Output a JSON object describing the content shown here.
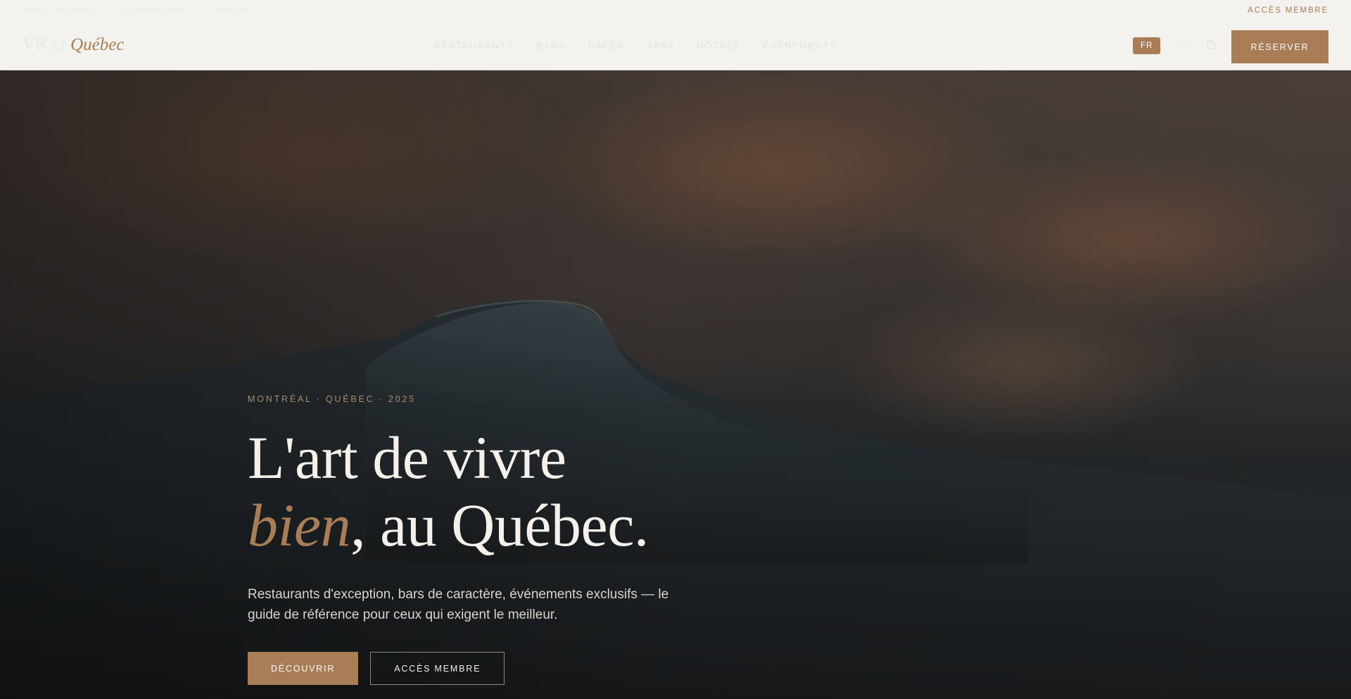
{
  "header": {
    "top_links": [
      "Notre mission",
      "Partenaires",
      "Contact"
    ],
    "member_access": "ACCÈS MEMBRE",
    "logo": {
      "main": "VRAI",
      "accent": "Québec"
    },
    "nav": [
      "RESTAURANTS",
      "BARS",
      "CAFÉS",
      "SPAS",
      "HÔTELS",
      "ÉVÉNEMENTS"
    ],
    "languages": [
      {
        "code": "FR",
        "active": true
      },
      {
        "code": "EN",
        "active": false
      }
    ],
    "search_icon": "search-icon",
    "reserve_label": "RÉSERVER"
  },
  "hero": {
    "eyebrow": "MONTRÉAL · QUÉBEC · 2025",
    "headline_line1": "L'art de vivre",
    "headline_accent": "bien",
    "headline_line2_rest": ", au Québec.",
    "subtitle": "Restaurants d'exception, bars de caractère, événements exclusifs — le guide de référence pour ceux qui exigent le meilleur.",
    "primary_cta": "DÉCOUVRIR",
    "secondary_cta": "ACCÈS MEMBRE"
  },
  "colors": {
    "accent": "#a97d55",
    "header_bg": "#f4f2ee",
    "hero_text": "#f5f1ea"
  }
}
